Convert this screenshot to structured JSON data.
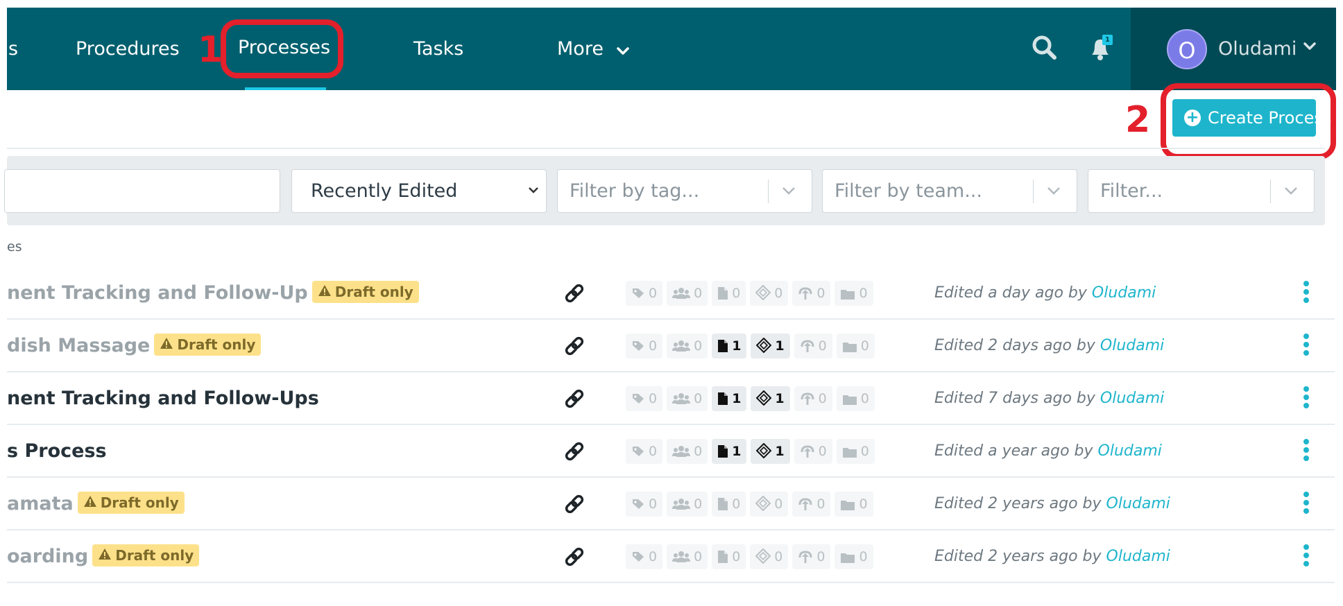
{
  "nav": {
    "items": [
      {
        "label": "s"
      },
      {
        "label": "Procedures"
      },
      {
        "label": "Processes"
      },
      {
        "label": "Tasks"
      },
      {
        "label": "More"
      }
    ],
    "notification_count": "1",
    "profile": {
      "initial": "O",
      "name": "Oludami"
    }
  },
  "annotations": {
    "first": "1",
    "second": "2"
  },
  "header": {
    "create_label": "Create Process"
  },
  "filters": {
    "search_value": "",
    "sort_selected": "Recently Edited",
    "tag_placeholder": "Filter by tag...",
    "team_placeholder": "Filter by team...",
    "other_placeholder": "Filter..."
  },
  "list": {
    "count_text": "es",
    "rows": [
      {
        "title": "nent Tracking and Follow-Up",
        "draft": true,
        "badge": "Draft only",
        "counts": [
          "0",
          "0",
          "0",
          "0",
          "0",
          "0"
        ],
        "edited": "Edited a day ago by",
        "user": "Oludami"
      },
      {
        "title": "dish Massage",
        "draft": true,
        "badge": "Draft only",
        "counts": [
          "0",
          "0",
          "1",
          "1",
          "0",
          "0"
        ],
        "edited": "Edited 2 days ago by",
        "user": "Oludami"
      },
      {
        "title": "nent Tracking and Follow-Ups",
        "draft": false,
        "badge": "",
        "counts": [
          "0",
          "0",
          "1",
          "1",
          "0",
          "0"
        ],
        "edited": "Edited 7 days ago by",
        "user": "Oludami"
      },
      {
        "title": "s Process",
        "draft": false,
        "badge": "",
        "counts": [
          "0",
          "0",
          "1",
          "1",
          "0",
          "0"
        ],
        "edited": "Edited a year ago by",
        "user": "Oludami"
      },
      {
        "title": "amata",
        "draft": true,
        "badge": "Draft only",
        "counts": [
          "0",
          "0",
          "0",
          "0",
          "0",
          "0"
        ],
        "edited": "Edited 2 years ago by",
        "user": "Oludami"
      },
      {
        "title": "oarding",
        "draft": true,
        "badge": "Draft only",
        "counts": [
          "0",
          "0",
          "0",
          "0",
          "0",
          "0"
        ],
        "edited": "Edited 2 years ago by",
        "user": "Oludami"
      }
    ]
  },
  "colors": {
    "nav_bg": "#005f6e",
    "accent": "#1eb5cc",
    "annotation": "#e3202b",
    "draft_badge": "#fde18a"
  },
  "icons": [
    "search-icon",
    "bell-icon",
    "chevron-down-icon",
    "plus-circle-icon",
    "link-icon",
    "tag-icon",
    "team-icon",
    "document-icon",
    "diamond-icon",
    "upload-icon",
    "folder-icon",
    "kebab-menu-icon",
    "warning-icon"
  ]
}
